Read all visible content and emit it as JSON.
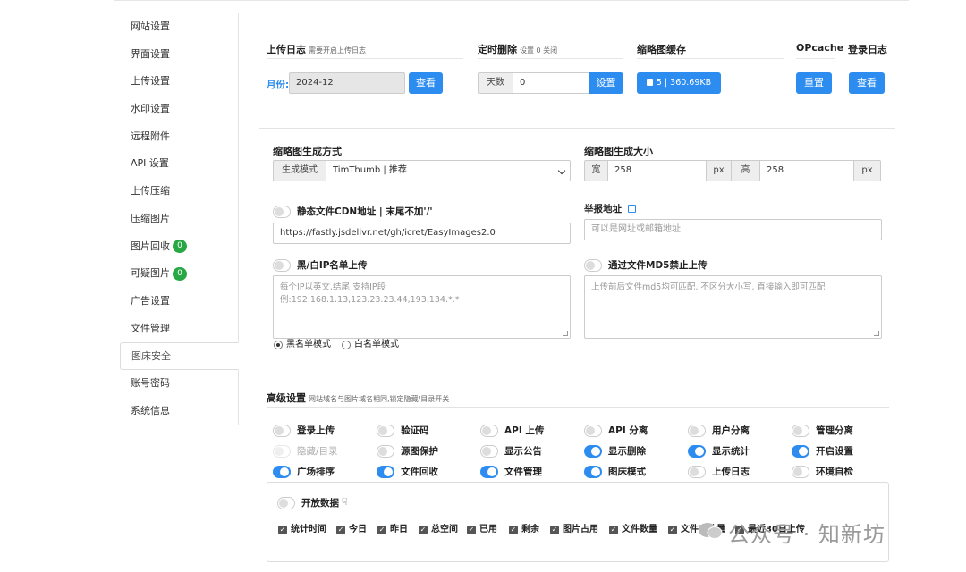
{
  "sidebar": {
    "items": [
      {
        "label": "网站设置"
      },
      {
        "label": "界面设置"
      },
      {
        "label": "上传设置"
      },
      {
        "label": "水印设置"
      },
      {
        "label": "远程附件"
      },
      {
        "label": "API 设置"
      },
      {
        "label": "上传压缩"
      },
      {
        "label": "压缩图片"
      },
      {
        "label": "图片回收",
        "badge": "0"
      },
      {
        "label": "可疑图片",
        "badge": "0"
      },
      {
        "label": "广告设置"
      },
      {
        "label": "文件管理"
      },
      {
        "label": "图床安全",
        "active": true
      },
      {
        "label": "账号密码"
      },
      {
        "label": "系统信息"
      }
    ]
  },
  "upload_log": {
    "title": "上传日志",
    "hint": "需要开启上传日志",
    "month_label": "月份:",
    "month_value": "2024-12",
    "view_button": "查看"
  },
  "scheduled_delete": {
    "title": "定时删除",
    "hint": "设置 0 关闭",
    "days_label": "天数",
    "days_value": "0",
    "set_button": "设置"
  },
  "thumb_cache": {
    "title": "缩略图缓存",
    "button": "5 | 360.69KB"
  },
  "opcache": {
    "title": "OPcache",
    "button": "重置"
  },
  "login_log": {
    "title": "登录日志",
    "button": "查看"
  },
  "thumb_method": {
    "title": "缩略图生成方式",
    "mode_label": "生成模式",
    "mode_value": "TimThumb | 推荐"
  },
  "thumb_size": {
    "title": "缩略图生成大小",
    "width_label": "宽",
    "width_value": "258",
    "width_unit": "px",
    "height_label": "高",
    "height_value": "258",
    "height_unit": "px"
  },
  "cdn": {
    "label": "静态文件CDN地址 | 末尾不加'/'",
    "value": "https://fastly.jsdelivr.net/gh/icret/EasyImages2.0",
    "enabled": false
  },
  "report": {
    "label": "举报地址",
    "placeholder": "可以是网址或邮箱地址"
  },
  "ip_list": {
    "label": "黑/白IP名单上传",
    "enabled": false,
    "placeholder": "每个IP以英文,结尾 支持IP段 例:192.168.1.13,123.23.23.44,193.134.*.*",
    "mode_black": "黑名单模式",
    "mode_white": "白名单模式"
  },
  "md5": {
    "label": "通过文件MD5禁止上传",
    "enabled": false,
    "placeholder": "上传前后文件md5均可匹配, 不区分大小写, 直接输入即可匹配"
  },
  "advanced": {
    "title": "高级设置",
    "hint": "网站域名与图片域名相同,锁定隐藏/目录开关",
    "toggles": [
      {
        "label": "登录上传",
        "on": false
      },
      {
        "label": "验证码",
        "on": false
      },
      {
        "label": "API 上传",
        "on": false
      },
      {
        "label": "API 分离",
        "on": false
      },
      {
        "label": "用户分离",
        "on": false
      },
      {
        "label": "管理分离",
        "on": false
      },
      {
        "label": "隐藏/目录",
        "on": false,
        "disabled": true
      },
      {
        "label": "源图保护",
        "on": false
      },
      {
        "label": "显示公告",
        "on": false
      },
      {
        "label": "显示删除",
        "on": true
      },
      {
        "label": "显示统计",
        "on": true
      },
      {
        "label": "开启设置",
        "on": true
      },
      {
        "label": "广场排序",
        "on": true
      },
      {
        "label": "文件回收",
        "on": true
      },
      {
        "label": "文件管理",
        "on": true
      },
      {
        "label": "图床模式",
        "on": true
      },
      {
        "label": "上传日志",
        "on": false
      },
      {
        "label": "环境自检",
        "on": false
      }
    ]
  },
  "open_data": {
    "label": "开放数据",
    "enabled": false,
    "checks": [
      "统计时间",
      "今日",
      "昨日",
      "总空间",
      "已用",
      "剩余",
      "图片占用",
      "文件数量",
      "文件夹数量",
      "最近30日上传"
    ]
  },
  "watermark": "公众号 · 知新坊",
  "colors": {
    "primary": "#2d8cf0",
    "badge": "#28a745"
  }
}
